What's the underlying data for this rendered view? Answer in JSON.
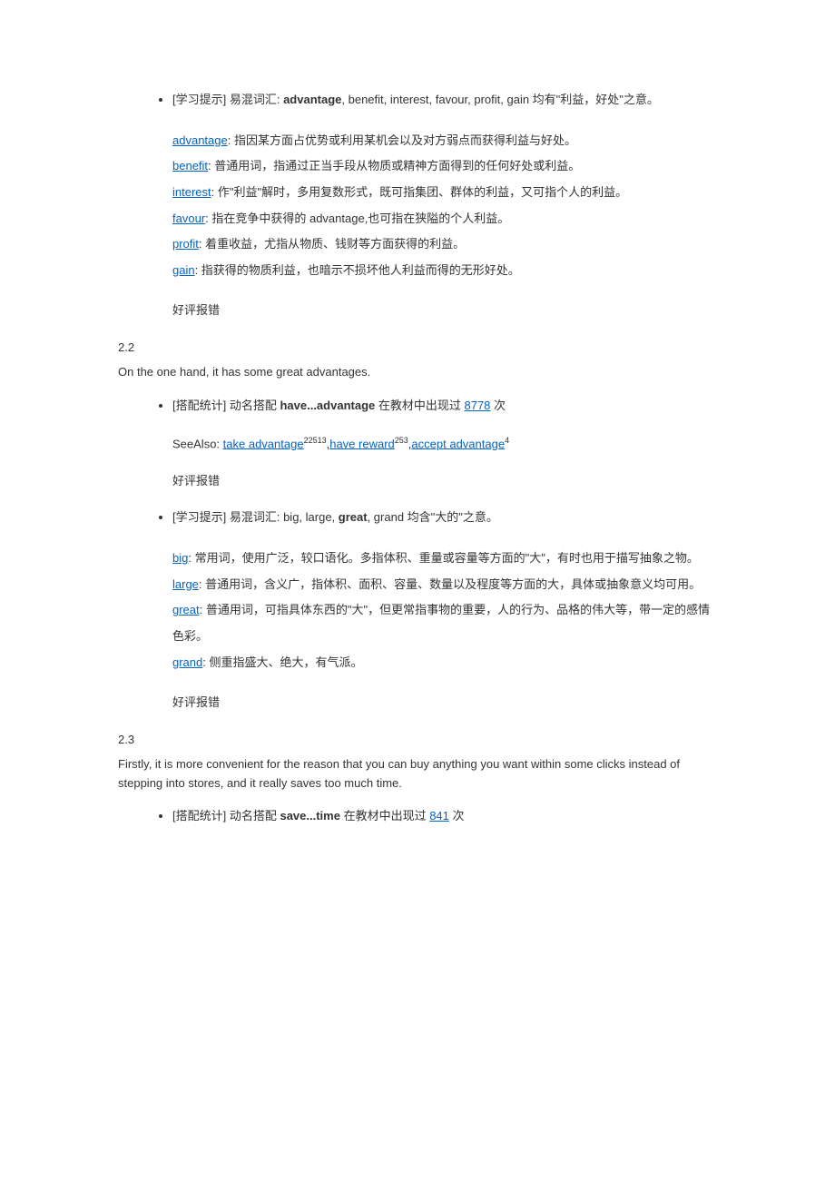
{
  "item1": {
    "tag": "[学习提示]",
    "label_prefix": " 易混词汇: ",
    "bold_word": "advantage",
    "label_suffix": ", benefit, interest, favour, profit, gain 均有\"利益，好处\"之意。",
    "defs": [
      {
        "word": "advantage",
        "text": ": 指因某方面占优势或利用某机会以及对方弱点而获得利益与好处。"
      },
      {
        "word": "benefit",
        "text": ": 普通用词，指通过正当手段从物质或精神方面得到的任何好处或利益。"
      },
      {
        "word": "interest",
        "text": ": 作\"利益\"解时，多用复数形式，既可指集团、群体的利益，又可指个人的利益。"
      },
      {
        "word": "favour",
        "text": ": 指在竞争中获得的 advantage,也可指在狭隘的个人利益。"
      },
      {
        "word": "profit",
        "text": ": 着重收益，尤指从物质、钱财等方面获得的利益。"
      },
      {
        "word": "gain",
        "text": ": 指获得的物质利益，也暗示不损坏他人利益而得的无形好处。"
      }
    ],
    "actions": "好评报错"
  },
  "sec22": {
    "num": "2.2",
    "sentence": "On the one hand, it has some great advantages."
  },
  "item2": {
    "tag": "[搭配统计]",
    "prefix": " 动名搭配 ",
    "bold_word": "have...advantage",
    "mid": " 在教材中出现过 ",
    "count": "8778",
    "suffix": " 次",
    "seealso_label": "SeeAlso: ",
    "seealso": [
      {
        "text": "take advantage",
        "sup": "22513",
        "trail": ","
      },
      {
        "text": "have reward",
        "sup": "253",
        "trail": ","
      },
      {
        "text": "accept advantage",
        "sup": "4",
        "trail": ""
      }
    ],
    "actions": "好评报错"
  },
  "item3": {
    "tag": "[学习提示]",
    "label_prefix": " 易混词汇: big, large, ",
    "bold_word": "great",
    "label_suffix": ", grand  均含\"大的\"之意。",
    "defs": [
      {
        "word": "big",
        "text": ": 常用词，使用广泛，较口语化。多指体积、重量或容量等方面的\"大\"，有时也用于描写抽象之物。"
      },
      {
        "word": "large",
        "text": ": 普通用词，含义广，指体积、面积、容量、数量以及程度等方面的大，具体或抽象意义均可用。"
      },
      {
        "word": "great",
        "text": ": 普通用词，可指具体东西的\"大\"，但更常指事物的重要，人的行为、品格的伟大等，带一定的感情色彩。"
      },
      {
        "word": "grand",
        "text": ": 侧重指盛大、绝大，有气派。"
      }
    ],
    "actions": "好评报错"
  },
  "sec23": {
    "num": "2.3",
    "sentence": "Firstly, it is more convenient for the reason that you can buy anything you want within some clicks instead of stepping into stores, and it really saves too much time."
  },
  "item4": {
    "tag": "[搭配统计]",
    "prefix": " 动名搭配 ",
    "bold_word": "save...time",
    "mid": " 在教材中出现过 ",
    "count": "841",
    "suffix": " 次"
  }
}
